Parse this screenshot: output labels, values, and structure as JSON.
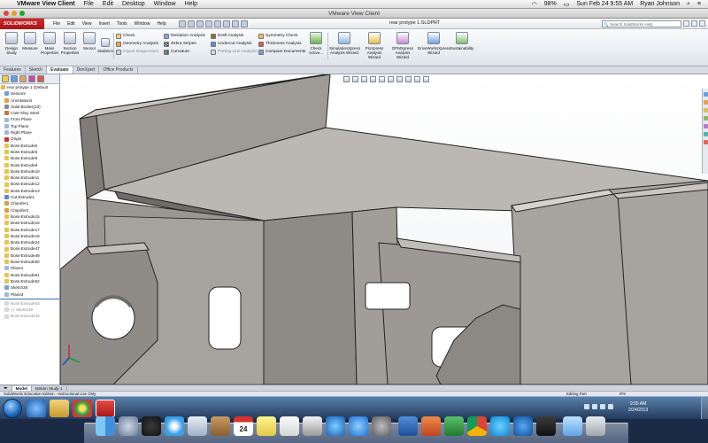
{
  "mac_menubar": {
    "app": "VMware View Client",
    "menus": [
      "File",
      "Edit",
      "Desktop",
      "Window",
      "Help"
    ],
    "battery": "98%",
    "datetime": "Sun Feb 24  9:55 AM",
    "user": "Ryan Johnson"
  },
  "vm_window": {
    "title": "VMware View Client"
  },
  "solidworks": {
    "logo": "SOLIDWORKS",
    "menus": [
      "File",
      "Edit",
      "View",
      "Insert",
      "Tools",
      "Window",
      "Help"
    ],
    "document_title": "rear protype 1.SLDPRT",
    "search_placeholder": "Search SolidWorks Help",
    "commands": {
      "design_study": "Design Study",
      "measure": "Measure",
      "mass_properties": "Mass Properties",
      "section_properties": "Section Properties",
      "sensor": "Sensor",
      "statistics": "Statistics",
      "check": "Check",
      "geometry_analysis": "Geometry Analysis",
      "import_diagnostics": "Import Diagnostics",
      "deviation_analysis": "Deviation Analysis",
      "zebra_stripes": "Zebra Stripes",
      "curvature": "Curvature",
      "draft_analysis": "Draft Analysis",
      "undercut_analysis": "Undercut Analysis",
      "parting_line_analysis": "Parting Line Analysis",
      "symmetry_check": "Symmetry Check",
      "thickness_analysis": "Thickness Analysis",
      "compare_documents": "Compare Documents",
      "check_active": "Check Active...",
      "simulation_xpress": "SimulationXpress Analysis Wizard",
      "flo_xpress": "FloXpress Analysis Wizard",
      "dfm_xpress": "DFMXpress Analysis Wizard",
      "drive_works_xpress": "DriveWorksXpress Wizard",
      "sustainability": "Sustainability"
    },
    "tabs": [
      "Features",
      "Sketch",
      "Evaluate",
      "DimXpert",
      "Office Products"
    ],
    "active_tab": "Evaluate",
    "tree": [
      "rear protype 1  (Default",
      "Sensors",
      "Annotations",
      "Solid Bodies(23)",
      "Cast Alloy Steel",
      "Front Plane",
      "Top Plane",
      "Right Plane",
      "Origin",
      "Boss-Extrude5",
      "Boss-Extrude6",
      "Boss-Extrude8",
      "Boss-Extrude9",
      "Boss-Extrude10",
      "Boss-Extrude11",
      "Boss-Extrude12",
      "Boss-Extrude13",
      "Cut-Extrude1",
      "Chamfer1",
      "Chamfer2",
      "Boss-Extrude15",
      "Boss-Extrude16",
      "Boss-Extrude17",
      "Boss-Extrude18",
      "Boss-Extrude24",
      "Boss-Extrude47",
      "Boss-Extrude49",
      "Boss-Extrude50",
      "Plane1",
      "Boss-Extrude51",
      "Boss-Extrude52",
      "Sketch38",
      "Plane3"
    ],
    "tree_rolled_back": [
      "Boss-Extrude53",
      "(-) Sketch39",
      "Boss-Extrude33"
    ],
    "bottom_tabs": [
      "Model",
      "Motion Study 1"
    ],
    "status_left": "SolidWorks Education Edition - Instructional Use Only",
    "status_mode": "Editing Part",
    "status_units": "IPS"
  },
  "windows_taskbar": {
    "time": "9:55 AM",
    "date": "2/24/2013"
  },
  "dock": {
    "calendar_day": "24",
    "icons": [
      "finder-icon",
      "launchpad-icon",
      "dashboard-icon",
      "safari-icon",
      "mail-icon",
      "contacts-icon",
      "calendar-icon",
      "notes-icon",
      "reminders-icon",
      "photos-icon",
      "itunes-icon",
      "app-store-icon",
      "preferences-icon",
      "word-icon",
      "powerpoint-icon",
      "excel-icon",
      "chrome-icon",
      "skype-icon",
      "teamviewer-icon",
      "vmware-icon",
      "folder-icon",
      "trash-icon"
    ]
  }
}
